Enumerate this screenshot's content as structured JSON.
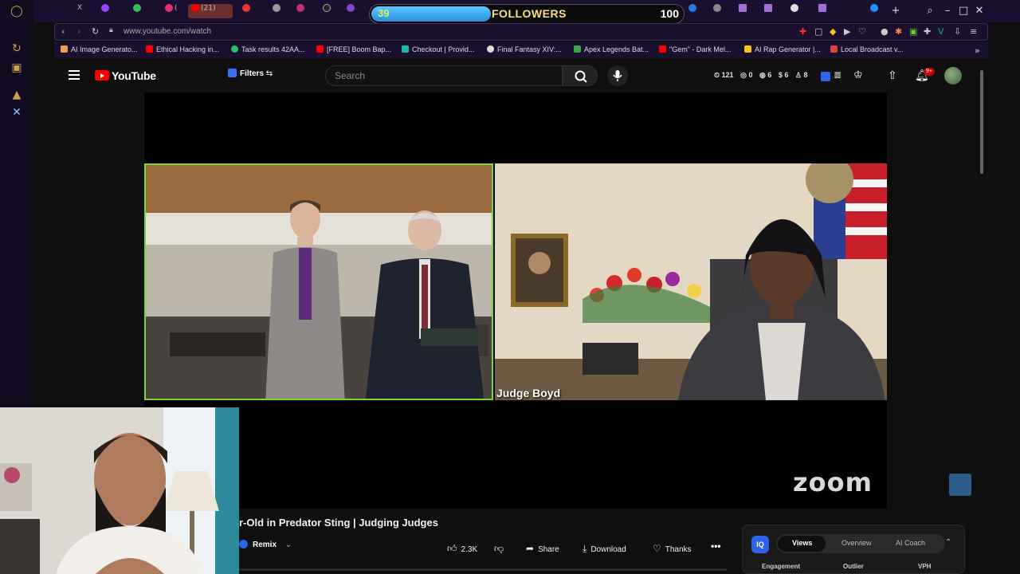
{
  "browser": {
    "url": "www.youtube.com/watch",
    "tabs": [
      {
        "label": "X",
        "color": "#ffffff"
      },
      {
        "label": "(21)",
        "color": "#ff0000"
      },
      {
        "label": "(",
        "color": "#e1306c"
      }
    ],
    "followers_widget": {
      "current": "39",
      "label": "FOLLOWERS",
      "goal": "100",
      "progress": 0.39
    }
  },
  "bookmarks": [
    {
      "label": "AI Image Generato...",
      "color": "#e8a34a"
    },
    {
      "label": "Ethical Hacking in...",
      "color": "#ff0000"
    },
    {
      "label": "Task results 42AA...",
      "color": "#23c16b"
    },
    {
      "label": "[FREE] Boom Bap...",
      "color": "#ff0000"
    },
    {
      "label": "Checkout | Provid...",
      "color": "#1bb8a4"
    },
    {
      "label": "Final Fantasy XIV:...",
      "color": "#dddddd"
    },
    {
      "label": "Apex Legends Bat...",
      "color": "#39a845"
    },
    {
      "label": "\"Gem\" - Dark Mel...",
      "color": "#ff0000"
    },
    {
      "label": "AI Rap Generator |...",
      "color": "#f5c518"
    },
    {
      "label": "Local Broadcast v...",
      "color": "#d8453a"
    }
  ],
  "youtube": {
    "logo_text": "YouTube",
    "filters_label": "Filters",
    "search_placeholder": "Search",
    "stats": [
      "121",
      "0",
      "6",
      "6",
      "8"
    ],
    "notification_badge": "9+"
  },
  "video": {
    "participant_label": "Judge Boyd",
    "zoom_wordmark": "zoom",
    "title": "r-Old in Predator Sting | Judging Judges"
  },
  "actions": {
    "remix_label": "Remix",
    "like_count": "2.3K",
    "share_label": "Share",
    "download_label": "Download",
    "thanks_label": "Thanks",
    "more_label": "•••"
  },
  "analytics": {
    "badge": "IQ",
    "tabs": [
      "Views",
      "Overview",
      "AI Coach"
    ],
    "active_tab": "Views",
    "columns": [
      "Engagement",
      "Outlier",
      "VPH"
    ]
  }
}
